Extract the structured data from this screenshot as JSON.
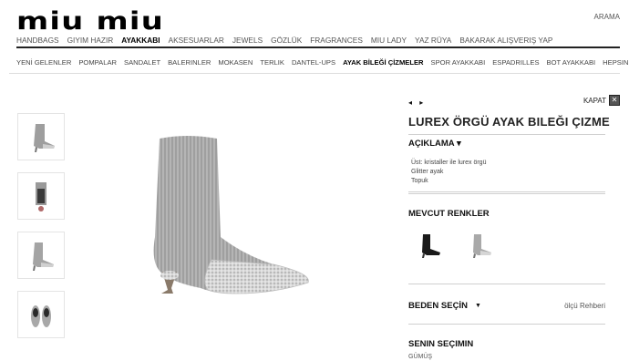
{
  "header": {
    "logo_text": "miu miu",
    "search_label": "ARAMA"
  },
  "main_nav": [
    {
      "label": "HANDBAGS",
      "active": false
    },
    {
      "label": "GIYIM HAZIR",
      "active": false
    },
    {
      "label": "AYAKKABI",
      "active": true
    },
    {
      "label": "AKSESUARLAR",
      "active": false
    },
    {
      "label": "JEWELS",
      "active": false
    },
    {
      "label": "GÖZLÜK",
      "active": false
    },
    {
      "label": "FRAGRANCES",
      "active": false
    },
    {
      "label": "MIU LADY",
      "active": false
    },
    {
      "label": "YAZ RÜYA",
      "active": false
    },
    {
      "label": "BAKARAK ALIŞVERIŞ YAP",
      "active": false
    }
  ],
  "sub_nav": [
    {
      "label": "YENİ GELENLER",
      "active": false
    },
    {
      "label": "POMPALAR",
      "active": false
    },
    {
      "label": "SANDALET",
      "active": false
    },
    {
      "label": "BALERINLER",
      "active": false
    },
    {
      "label": "MOKASEN",
      "active": false
    },
    {
      "label": "TERLIK",
      "active": false
    },
    {
      "label": "DANTEL-UPS",
      "active": false
    },
    {
      "label": "AYAK BİLEĞİ ÇİZMELER",
      "active": true
    },
    {
      "label": "SPOR AYAKKABI",
      "active": false
    },
    {
      "label": "ESPADRILLES",
      "active": false
    },
    {
      "label": "BOT AYAKKABI",
      "active": false
    },
    {
      "label": "HEPSINI GÖR",
      "active": false
    }
  ],
  "product": {
    "pager": "◂ ▸",
    "close_label": "KAPAT",
    "close_icon": "x-icon",
    "title": "LUREX ÖRGÜ AYAK BILEĞI ÇIZME",
    "description_heading": "AÇIKLAMA ▾",
    "description_lines": [
      "Üst: kristaller ile lurex örgü",
      "Glitter ayak",
      "Topuk"
    ],
    "colors_heading": "MEVCUT RENKLER",
    "size_heading": "BEDEN SEÇİN",
    "size_caret": "▼",
    "size_guide": "ölçü Rehberi",
    "selection_heading": "SENIN SEÇIMIN",
    "selection_value": "GÜMÜŞ"
  },
  "colors": {
    "silver": "#a9a9a9",
    "black": "#1a1a1a",
    "glitter": "#d6d6d6"
  }
}
